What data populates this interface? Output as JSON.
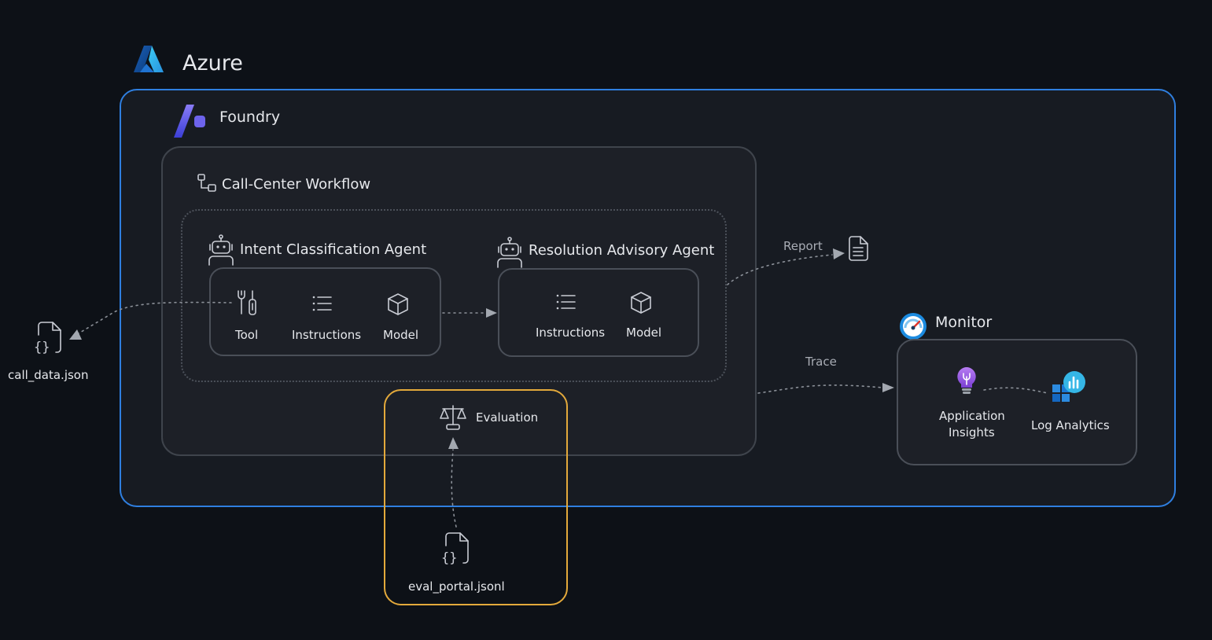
{
  "azure": {
    "label": "Azure"
  },
  "foundry": {
    "label": "Foundry"
  },
  "workflow": {
    "label": "Call-Center Workflow"
  },
  "intent_agent": {
    "label": "Intent Classification Agent",
    "items": [
      "Tool",
      "Instructions",
      "Model"
    ]
  },
  "resolution_agent": {
    "label": "Resolution Advisory Agent",
    "items": [
      "Instructions",
      "Model"
    ]
  },
  "evaluation": {
    "label": "Evaluation",
    "file": "eval_portal.jsonl"
  },
  "call_data": {
    "label": "call_data.json"
  },
  "report": {
    "label": "Report"
  },
  "trace": {
    "label": "Trace"
  },
  "monitor": {
    "label": "Monitor",
    "app_insights_line1": "Application",
    "app_insights_line2": "Insights",
    "log_analytics": "Log Analytics"
  },
  "colors": {
    "azure_border": "#2f7fe0",
    "eval_border": "#e3a93b",
    "panel_border": "#4a4f58",
    "background": "#0d1117"
  }
}
